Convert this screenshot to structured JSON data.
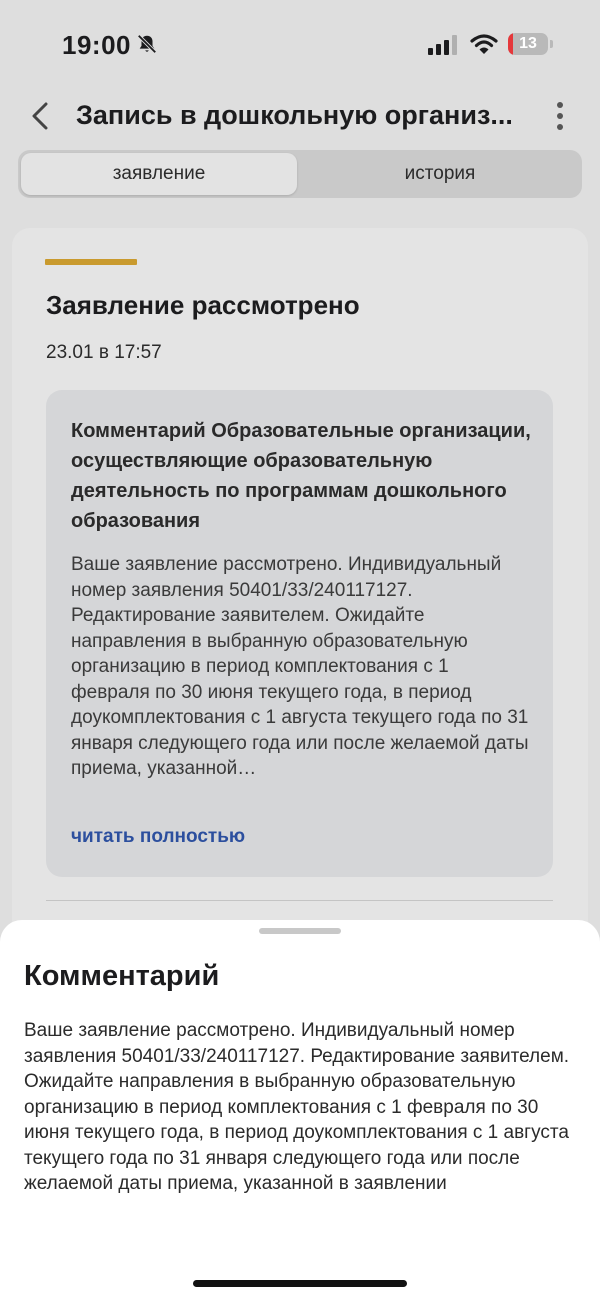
{
  "status_bar": {
    "time": "19:00",
    "battery": "13",
    "battery_level_percent": 13,
    "battery_color": "#e5383b"
  },
  "header": {
    "title": "Запись в дошкольную организ..."
  },
  "tabs": [
    {
      "label": "заявление",
      "active": true
    },
    {
      "label": "история",
      "active": false
    }
  ],
  "card": {
    "accent_color": "#c99a2e",
    "title": "Заявление рассмотрено",
    "date": "23.01 в 17:57",
    "comment_heading": "Комментарий Образовательные организации, осуществляющие образовательную деятельность по программам дошкольного образования",
    "comment_body": "Ваше заявление рассмотрено. Индивидуальный номер заявления 50401/33/240117127. Редактирование заявителем. Ожидайте направления в выбранную образовательную организацию в период комплектования с 1 февраля по 30 июня текущего года, в период доукомплектования с 1 августа текущего года по 31 января следующего года или после желаемой даты приема, указанной…",
    "read_more": "читать полностью",
    "link_color": "#2c4f9e"
  },
  "sheet": {
    "title": "Комментарий",
    "body": "Ваше заявление рассмотрено. Индивидуальный номер заявления 50401/33/240117127. Редактирование заявителем. Ожидайте направления в выбранную образовательную организацию в период комплектования с 1 февраля по 30 июня текущего года, в период доукомплектования с 1 августа текущего года по 31 января следующего года или после желаемой даты приема, указанной в заявлении"
  }
}
